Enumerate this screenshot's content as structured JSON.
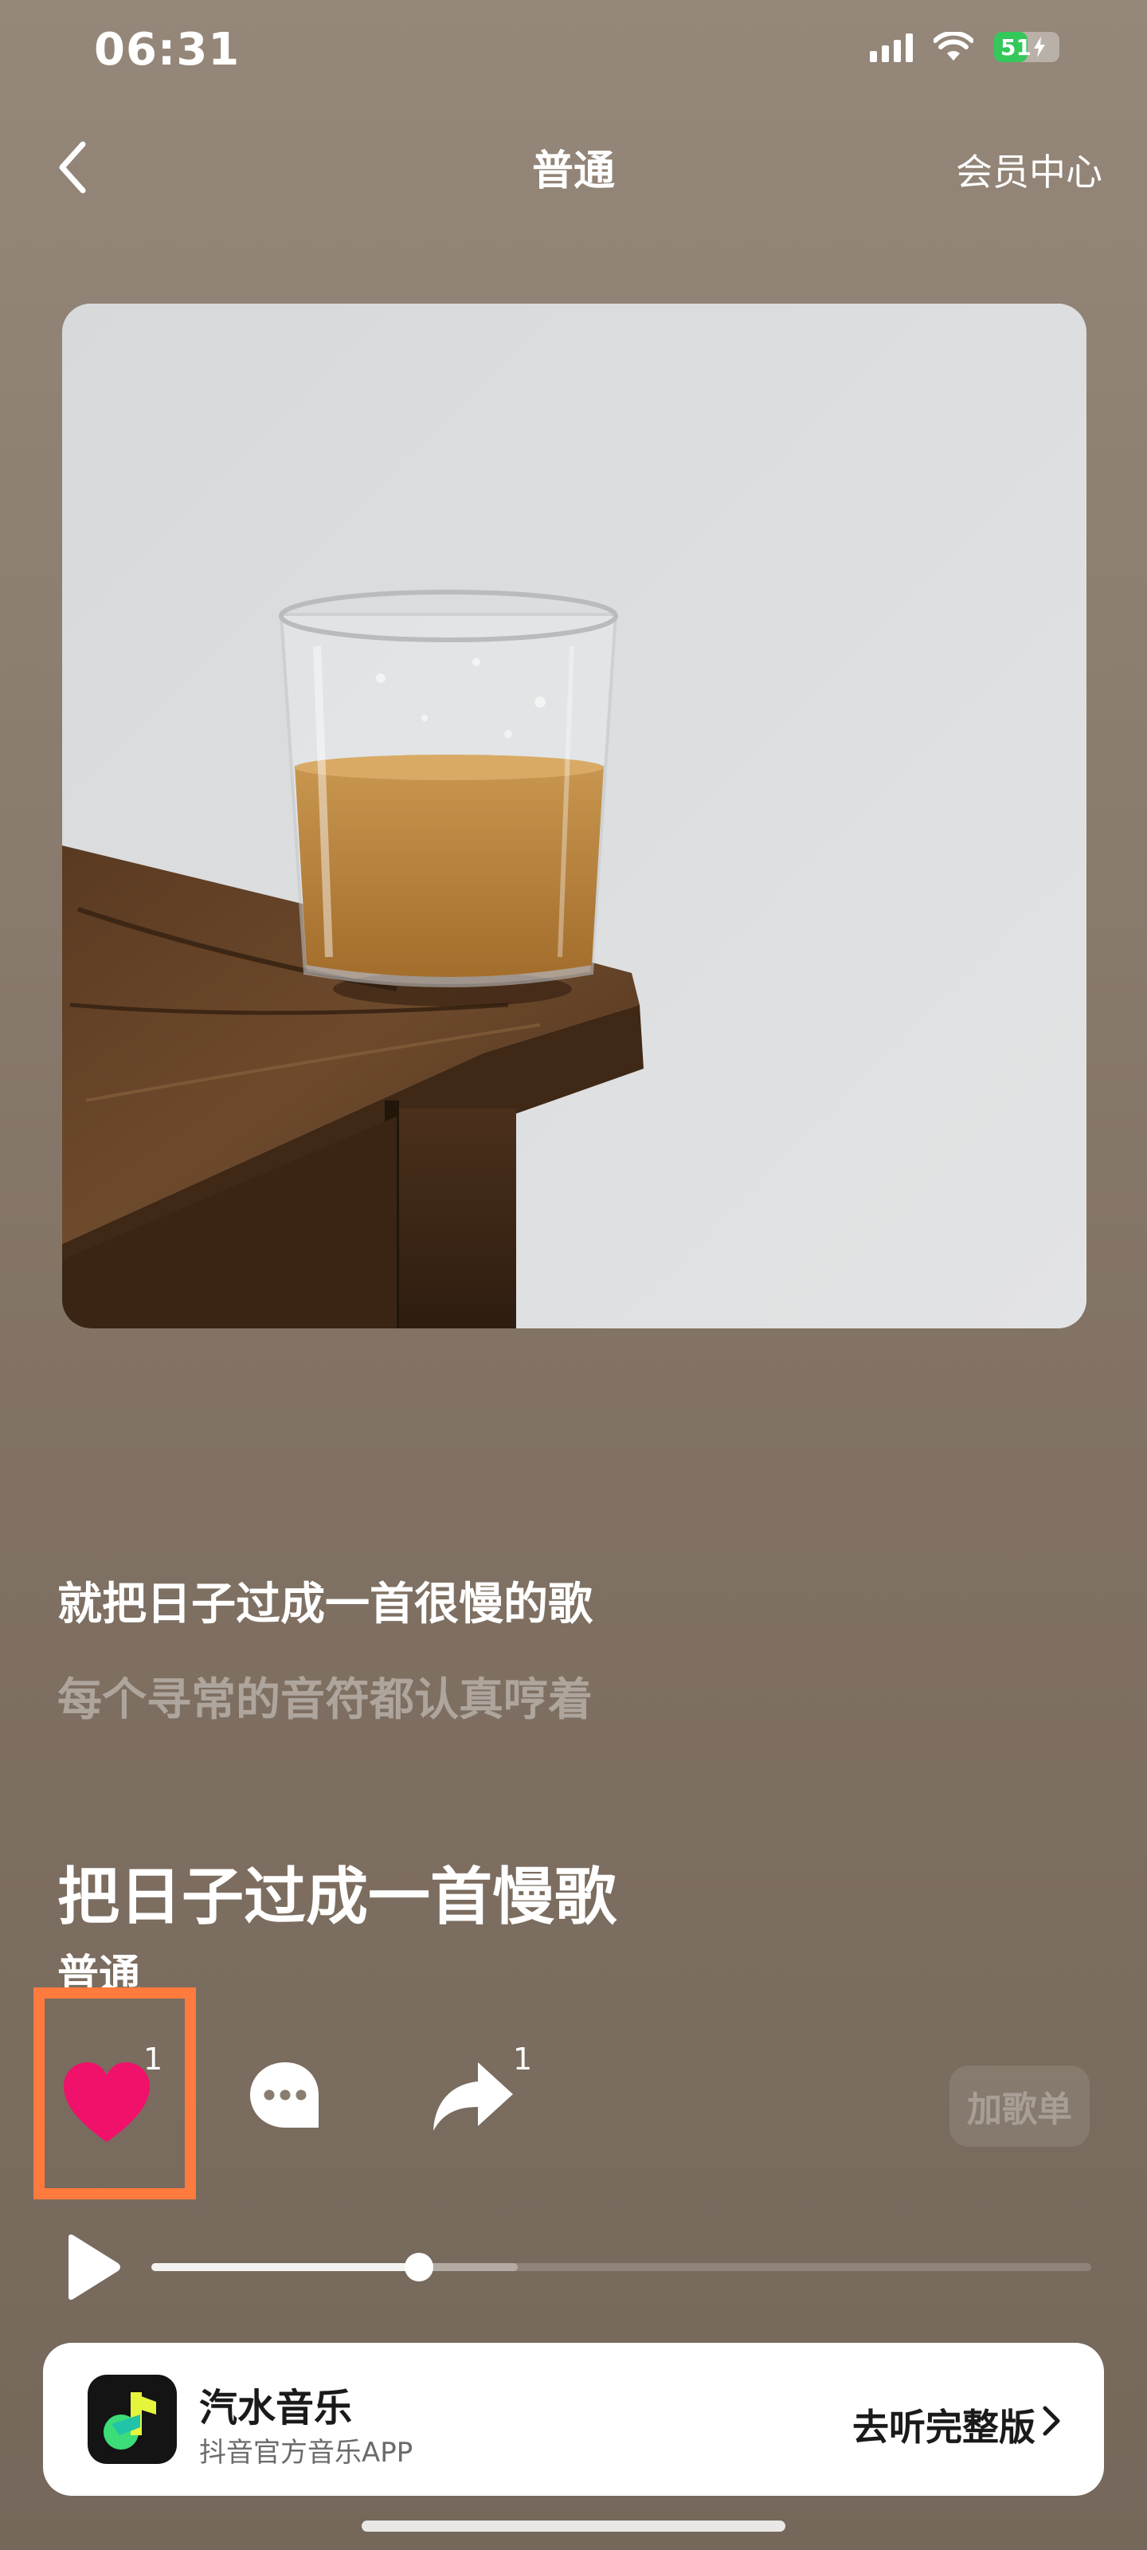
{
  "status_bar": {
    "time": "06:31",
    "battery_level": "51"
  },
  "header": {
    "title": "普通",
    "vip_center": "会员中心"
  },
  "lyrics": {
    "current": "就把日子过成一首很慢的歌",
    "next": "每个寻常的音符都认真哼着"
  },
  "song": {
    "title": "把日子过成一首慢歌",
    "artist": "普通"
  },
  "actions": {
    "like_count": "1",
    "share_count": "1",
    "add_to_playlist": "加歌单"
  },
  "playback": {
    "progress_fraction": 0.285,
    "buffered_fraction": 0.39
  },
  "promo": {
    "app_name": "汽水音乐",
    "app_desc": "抖音官方音乐APP",
    "cta": "去听完整版"
  },
  "colors": {
    "like_heart": "#f0116a",
    "highlight_box": "#ff7a3d",
    "logo_green": "#3cdc78",
    "logo_yellow": "#e4f53c"
  }
}
